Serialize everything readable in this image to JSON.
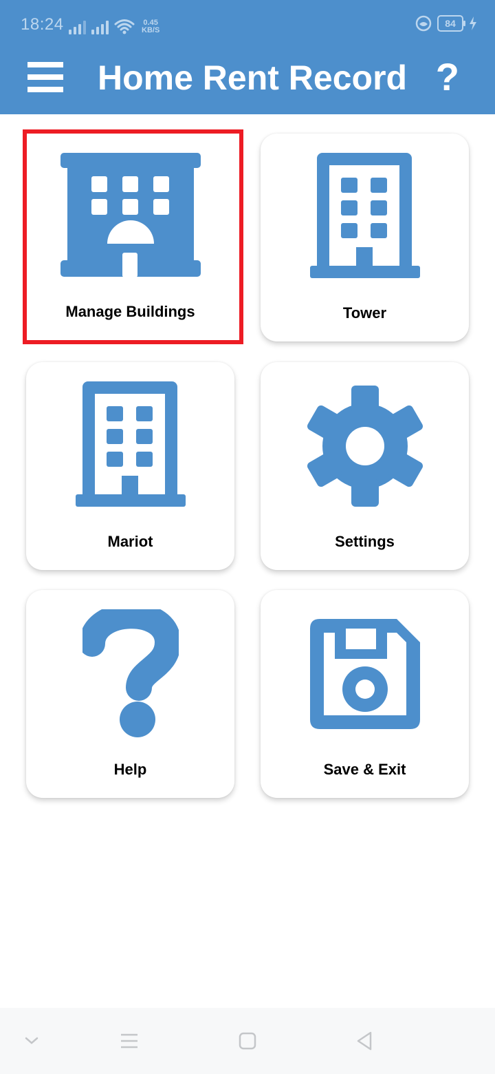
{
  "status_bar": {
    "time": "18:24",
    "net_speed_value": "0.45",
    "net_speed_unit": "KB/S",
    "battery_level": "84"
  },
  "app_bar": {
    "title": "Home Rent Record",
    "help_label": "?",
    "menu_icon": "hamburger-menu-icon"
  },
  "cards": [
    {
      "label": "Manage Buildings",
      "icon": "building-icon",
      "highlighted": true
    },
    {
      "label": "Tower",
      "icon": "office-building-icon"
    },
    {
      "label": "Mariot",
      "icon": "office-building-icon"
    },
    {
      "label": "Settings",
      "icon": "gear-icon"
    },
    {
      "label": "Help",
      "icon": "question-icon"
    },
    {
      "label": "Save & Exit",
      "icon": "floppy-disk-icon"
    }
  ],
  "nav_bar": {
    "items": [
      "chevron-down-icon",
      "menu-lines-icon",
      "home-square-icon",
      "back-triangle-icon"
    ]
  },
  "colors": {
    "primary": "#4d8fcc",
    "highlight_border": "#ed1c24",
    "status_text": "#bcd6ee",
    "nav_background": "#f7f8f9"
  }
}
